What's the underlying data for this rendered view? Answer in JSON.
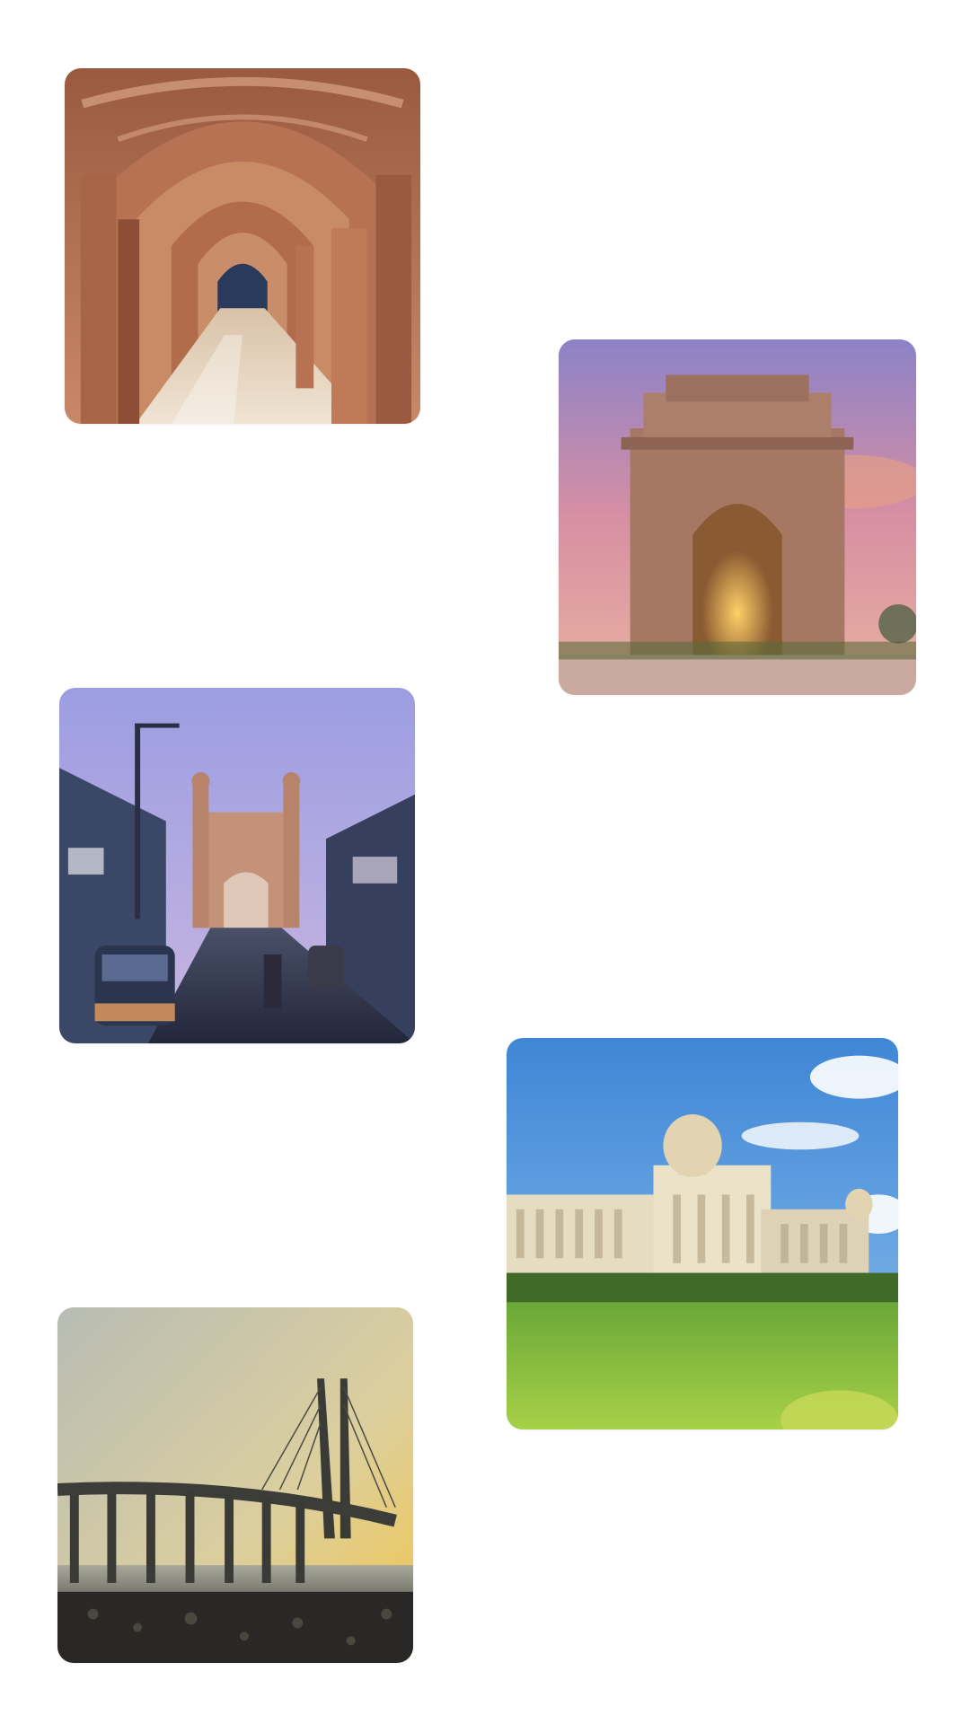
{
  "screen": {
    "background": "#ffffff"
  },
  "gallery": {
    "items": [
      {
        "subject": "ornate-arched-corridor",
        "palette": [
          "#b86e4e",
          "#e4b48c",
          "#7a3a2a"
        ]
      },
      {
        "subject": "india-gate-at-dusk",
        "palette": [
          "#c89a8e",
          "#a0806a",
          "#e8b04a"
        ]
      },
      {
        "subject": "charminar-street-at-dusk",
        "palette": [
          "#a7a6e0",
          "#3a3f5c",
          "#c28a6a"
        ]
      },
      {
        "subject": "vidhana-soudha-with-lawn",
        "palette": [
          "#4f8fd8",
          "#e8dcc0",
          "#8ac040"
        ]
      },
      {
        "subject": "sea-link-bridge-at-sunset",
        "palette": [
          "#d8c8a0",
          "#f0c050",
          "#2a2a2a"
        ]
      }
    ]
  }
}
